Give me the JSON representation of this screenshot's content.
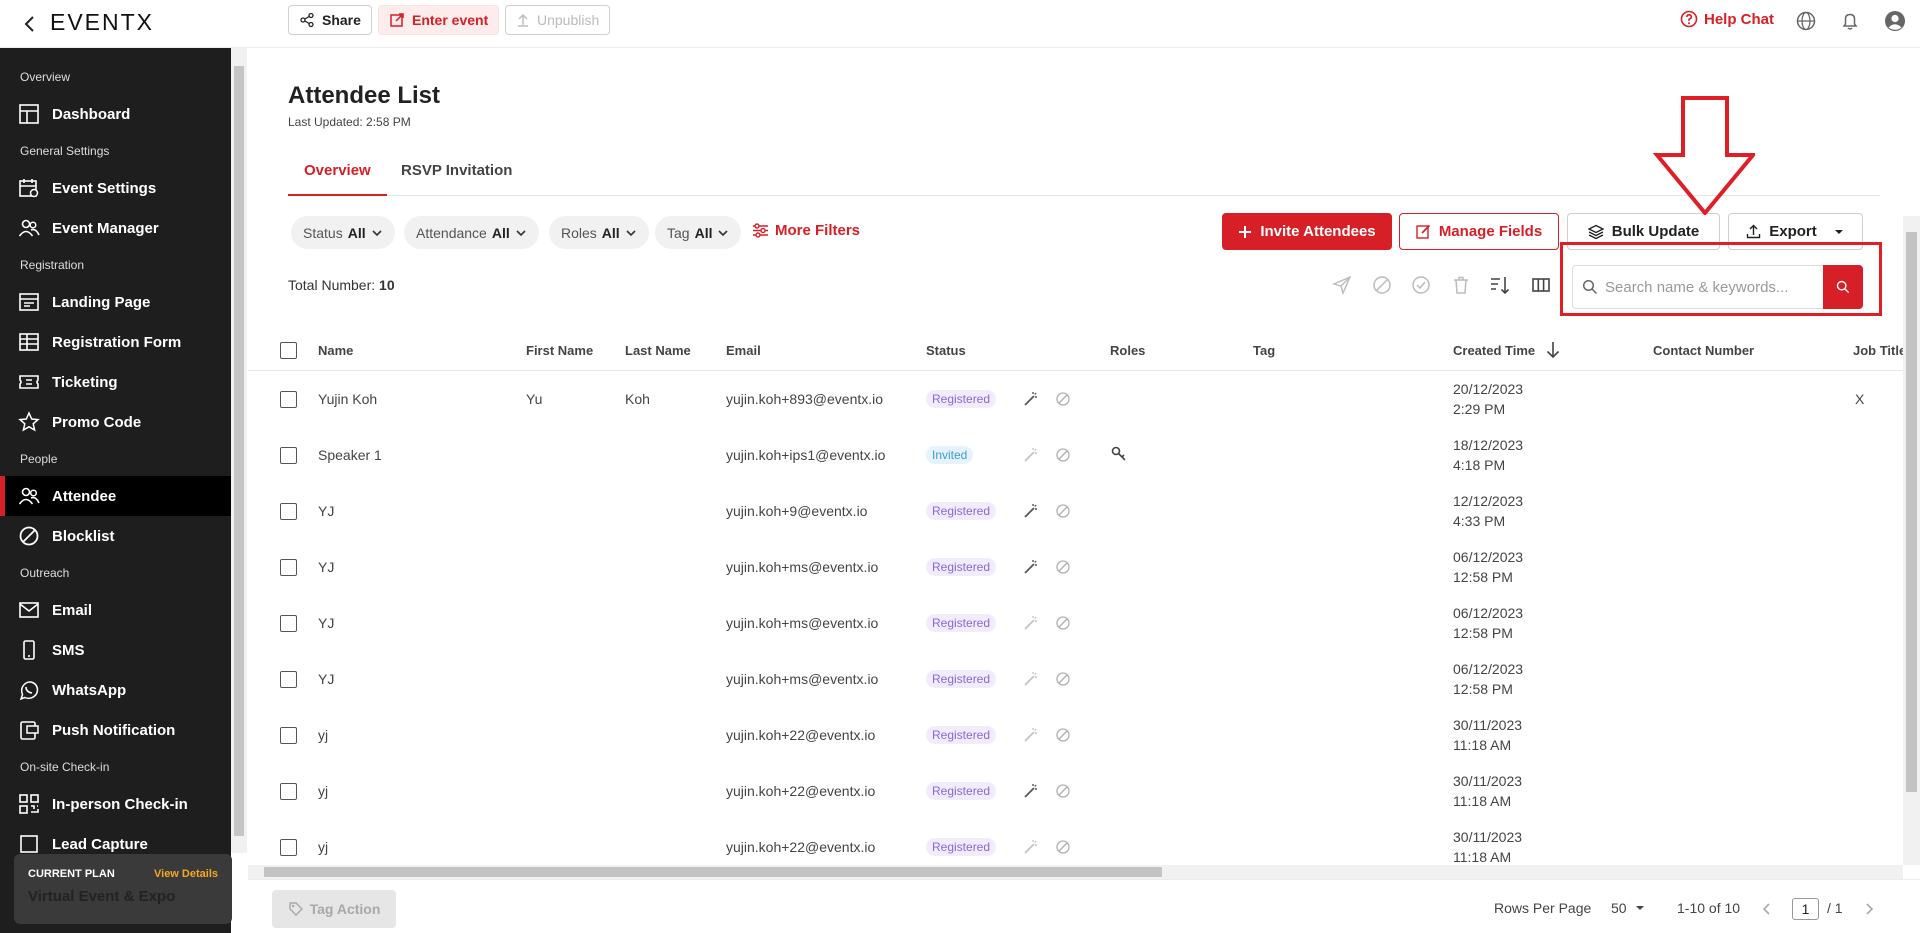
{
  "app": {
    "logo": "EVENTX"
  },
  "topbar": {
    "share": "Share",
    "enter_event": "Enter event",
    "unpublish": "Unpublish",
    "help_chat": "Help Chat"
  },
  "sidebar": {
    "sections": [
      {
        "title": "Overview",
        "items": [
          {
            "label": "Dashboard",
            "icon": "dashboard-icon"
          }
        ]
      },
      {
        "title": "General Settings",
        "items": [
          {
            "label": "Event Settings",
            "icon": "calendar-settings-icon"
          },
          {
            "label": "Event Manager",
            "icon": "people-icon"
          }
        ]
      },
      {
        "title": "Registration",
        "items": [
          {
            "label": "Landing Page",
            "icon": "landing-page-icon"
          },
          {
            "label": "Registration Form",
            "icon": "table-icon"
          },
          {
            "label": "Ticketing",
            "icon": "ticket-icon"
          },
          {
            "label": "Promo Code",
            "icon": "star-icon"
          }
        ]
      },
      {
        "title": "People",
        "items": [
          {
            "label": "Attendee",
            "icon": "attendee-icon",
            "active": true
          },
          {
            "label": "Blocklist",
            "icon": "block-icon"
          }
        ]
      },
      {
        "title": "Outreach",
        "items": [
          {
            "label": "Email",
            "icon": "mail-icon"
          },
          {
            "label": "SMS",
            "icon": "phone-icon"
          },
          {
            "label": "WhatsApp",
            "icon": "whatsapp-icon"
          },
          {
            "label": "Push Notification",
            "icon": "push-notification-icon"
          }
        ]
      },
      {
        "title": "On-site Check-in",
        "items": [
          {
            "label": "In-person Check-in",
            "icon": "qr-code-icon"
          },
          {
            "label": "Lead Capture",
            "icon": "lead-capture-icon"
          }
        ]
      }
    ],
    "plan": {
      "current_label": "CURRENT PLAN",
      "view_details": "View Details",
      "name": "Virtual Event & Expo"
    }
  },
  "page": {
    "title": "Attendee List",
    "last_updated": "Last Updated: 2:58 PM",
    "tabs": [
      "Overview",
      "RSVP Invitation"
    ]
  },
  "filters": [
    {
      "label": "Status",
      "value": "All"
    },
    {
      "label": "Attendance",
      "value": "All"
    },
    {
      "label": "Roles",
      "value": "All"
    },
    {
      "label": "Tag",
      "value": "All"
    }
  ],
  "more_filters": "More Filters",
  "actions": {
    "invite": "Invite Attendees",
    "manage_fields": "Manage Fields",
    "bulk_update": "Bulk Update",
    "export": "Export"
  },
  "total": {
    "label": "Total Number:",
    "value": "10"
  },
  "search": {
    "placeholder": "Search name & keywords..."
  },
  "table": {
    "columns": [
      "Name",
      "First Name",
      "Last Name",
      "Email",
      "Status",
      "Roles",
      "Tag",
      "Created Time",
      "Contact Number",
      "Job Title"
    ],
    "rows": [
      {
        "name": "Yujin Koh",
        "first": "Yu",
        "last": "Koh",
        "email": "yujin.koh+893@eventx.io",
        "status": "Registered",
        "date": "20/12/2023",
        "time": "2:29 PM",
        "job": "X",
        "role_icon": false,
        "wand_active": true
      },
      {
        "name": "Speaker 1",
        "first": "",
        "last": "",
        "email": "yujin.koh+ips1@eventx.io",
        "status": "Invited",
        "date": "18/12/2023",
        "time": "4:18 PM",
        "job": "",
        "role_icon": true,
        "wand_active": false
      },
      {
        "name": "YJ",
        "first": "",
        "last": "",
        "email": "yujin.koh+9@eventx.io",
        "status": "Registered",
        "date": "12/12/2023",
        "time": "4:33 PM",
        "job": "",
        "role_icon": false,
        "wand_active": true
      },
      {
        "name": "YJ",
        "first": "",
        "last": "",
        "email": "yujin.koh+ms@eventx.io",
        "status": "Registered",
        "date": "06/12/2023",
        "time": "12:58 PM",
        "job": "",
        "role_icon": false,
        "wand_active": true
      },
      {
        "name": "YJ",
        "first": "",
        "last": "",
        "email": "yujin.koh+ms@eventx.io",
        "status": "Registered",
        "date": "06/12/2023",
        "time": "12:58 PM",
        "job": "",
        "role_icon": false,
        "wand_active": false
      },
      {
        "name": "YJ",
        "first": "",
        "last": "",
        "email": "yujin.koh+ms@eventx.io",
        "status": "Registered",
        "date": "06/12/2023",
        "time": "12:58 PM",
        "job": "",
        "role_icon": false,
        "wand_active": false
      },
      {
        "name": "yj",
        "first": "",
        "last": "",
        "email": "yujin.koh+22@eventx.io",
        "status": "Registered",
        "date": "30/11/2023",
        "time": "11:18 AM",
        "job": "",
        "role_icon": false,
        "wand_active": false
      },
      {
        "name": "yj",
        "first": "",
        "last": "",
        "email": "yujin.koh+22@eventx.io",
        "status": "Registered",
        "date": "30/11/2023",
        "time": "11:18 AM",
        "job": "",
        "role_icon": false,
        "wand_active": true
      },
      {
        "name": "yj",
        "first": "",
        "last": "",
        "email": "yujin.koh+22@eventx.io",
        "status": "Registered",
        "date": "30/11/2023",
        "time": "11:18 AM",
        "job": "",
        "role_icon": false,
        "wand_active": false
      }
    ]
  },
  "footer": {
    "tag_action": "Tag Action",
    "rows_per_page_label": "Rows Per Page",
    "rows_per_page": "50",
    "range": "1-10 of 10",
    "page": "1",
    "page_total": "/ 1"
  },
  "colors": {
    "accent": "#d61f26",
    "sidebar_bg": "#1e1e1e",
    "highlight_box": "#e01e26"
  }
}
